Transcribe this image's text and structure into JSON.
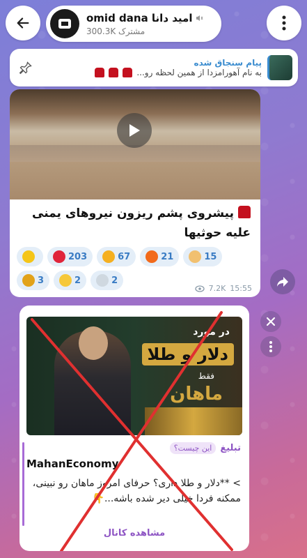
{
  "header": {
    "channel_name": "omid dana امید دانا",
    "subscribers": "300.3K مشترک"
  },
  "pinned": {
    "title": "پیام سنجاق شده",
    "preview": "به نام آهورامزدا از همین لحظه رو..."
  },
  "post": {
    "text": "پیشروی پشم ریزون نیروهای یمنی علیه حوثیها",
    "views": "7.2K",
    "time": "15:55",
    "reactions": [
      {
        "emoji": "star",
        "count": ""
      },
      {
        "emoji": "heart",
        "count": "203"
      },
      {
        "emoji": "starstruck",
        "count": "67"
      },
      {
        "emoji": "fire",
        "count": "21"
      },
      {
        "emoji": "clap",
        "count": "15"
      },
      {
        "emoji": "trophy",
        "count": "3"
      },
      {
        "emoji": "grin",
        "count": "2"
      },
      {
        "emoji": "dove",
        "count": "2"
      }
    ]
  },
  "ad": {
    "image_line1": "در مورد",
    "image_line2": "دلار و طلا",
    "image_line3": "فقط",
    "image_line4": "ماهان",
    "label": "تبلیغ",
    "what_is_this": "این چیست؟",
    "channel": "MahanEconomy",
    "body": "> **دلار و طلا داری؟ حرفای امروز ماهان رو نبینی، ممکنه فردا خیلی دیر شده باشه...👇",
    "view_channel": "مشاهده کانال"
  },
  "colors": {
    "accent_blue": "#3a7cc4",
    "ad_purple": "#8e55c4",
    "cross_red": "#e03030"
  }
}
